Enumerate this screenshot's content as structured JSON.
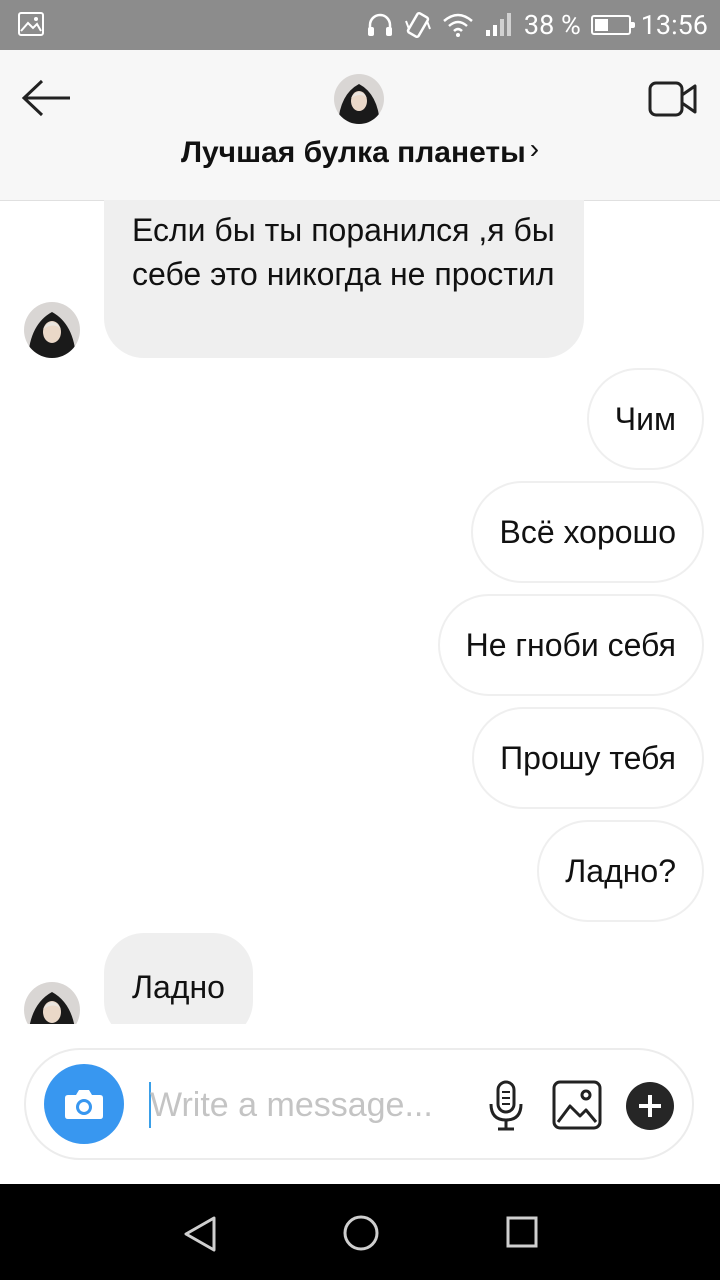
{
  "status_bar": {
    "battery": "38 %",
    "time": "13:56",
    "icons": [
      "gallery-icon",
      "headphones-icon",
      "vibrate-icon",
      "wifi-icon",
      "signal-icon",
      "battery-icon"
    ]
  },
  "header": {
    "title": "Лучшая булка планеты",
    "chevron": "›",
    "icons": [
      "back-arrow-icon",
      "video-call-icon"
    ]
  },
  "messages": {
    "m1": "Если бы ты поранился ,я бы себе это никогда не простил",
    "m2": "Чим",
    "m3": "Всё хорошо",
    "m4": "Не гноби себя",
    "m5": "Прошу тебя",
    "m6": "Ладно?",
    "m7": "Ладно"
  },
  "composer": {
    "placeholder": "Write a message...",
    "icons": [
      "camera-icon",
      "mic-icon",
      "image-icon",
      "plus-icon"
    ]
  },
  "nav_bar": {
    "icons": [
      "back-triangle-icon",
      "home-circle-icon",
      "recents-square-icon"
    ]
  },
  "colors": {
    "status_bar": "#8c8c8c",
    "header_bg": "#f7f7f7",
    "incoming_bubble": "#efefef",
    "camera_button": "#3897f0",
    "nav_bar": "#000000"
  }
}
